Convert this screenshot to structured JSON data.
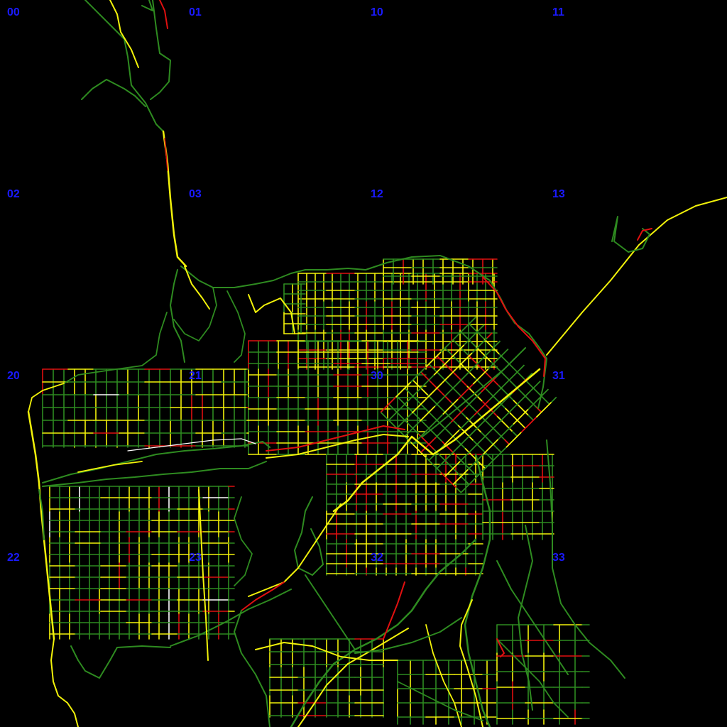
{
  "map": {
    "background": "#000000",
    "legend_colors": {
      "free_flow": "#2e8b20",
      "moderate": "#f2f20a",
      "congested": "#e01010",
      "closed": "#ffffff"
    },
    "tile_labels": [
      "00",
      "01",
      "10",
      "11",
      "02",
      "03",
      "12",
      "13",
      "20",
      "21",
      "30",
      "31",
      "22",
      "23",
      "32",
      "33"
    ],
    "label_color": "#1a1aff"
  }
}
